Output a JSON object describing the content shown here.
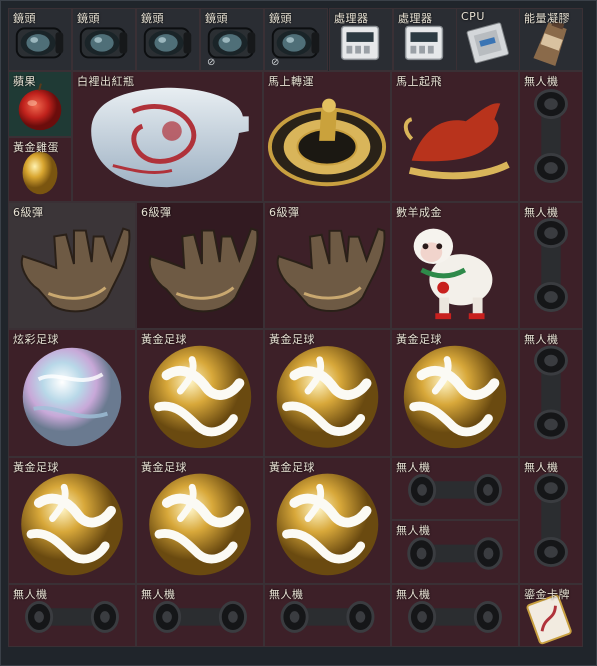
{
  "colors": {
    "panel_bg": "#20252b",
    "cell_dark": "#2a2d33",
    "cell_maroon": "#3d2028",
    "cell_maroon_dark": "#321a21",
    "cell_grey": "#3b3538",
    "cell_teal": "#1f3a35",
    "label_text": "#e8e2d4"
  },
  "top_row": [
    {
      "label": "鏡頭",
      "icon": "lens-icon",
      "mark": ""
    },
    {
      "label": "鏡頭",
      "icon": "lens-icon",
      "mark": ""
    },
    {
      "label": "鏡頭",
      "icon": "lens-icon",
      "mark": ""
    },
    {
      "label": "鏡頭",
      "icon": "lens-icon",
      "mark": "⊘"
    },
    {
      "label": "鏡頭",
      "icon": "lens-icon",
      "mark": "⊘"
    },
    {
      "label": "處理器",
      "icon": "processor-icon",
      "mark": ""
    },
    {
      "label": "處理器",
      "icon": "processor-icon",
      "mark": ""
    },
    {
      "label": "CPU",
      "icon": "cpu-chip-icon",
      "mark": ""
    },
    {
      "label": "能量凝膠",
      "icon": "energy-gel-icon",
      "mark": ""
    }
  ],
  "items": {
    "apple": {
      "label": "蘋果",
      "icon": "apple-icon"
    },
    "golden_egg": {
      "label": "黃金雞蛋",
      "icon": "golden-egg-icon"
    },
    "vase": {
      "label": "白裡出紅瓶",
      "icon": "porcelain-vase-icon"
    },
    "wheel": {
      "label": "馬上轉運",
      "icon": "fortune-wheel-icon"
    },
    "horse": {
      "label": "馬上起飛",
      "icon": "flying-horse-icon"
    },
    "drone_r1": {
      "label": "無人機",
      "icon": "drone-part-icon"
    },
    "glove1": {
      "label": "6級彈",
      "icon": "gauntlet-icon"
    },
    "glove2": {
      "label": "6級彈",
      "icon": "gauntlet-icon"
    },
    "glove3": {
      "label": "6級彈",
      "icon": "gauntlet-icon"
    },
    "sheep": {
      "label": "數羊成金",
      "icon": "sheep-figure-icon"
    },
    "drone_r2": {
      "label": "無人機",
      "icon": "drone-part-icon"
    },
    "colorball": {
      "label": "炫彩足球",
      "icon": "iridescent-football-icon"
    },
    "gold1": {
      "label": "黃金足球",
      "icon": "golden-football-icon"
    },
    "gold2": {
      "label": "黃金足球",
      "icon": "golden-football-icon"
    },
    "gold3": {
      "label": "黃金足球",
      "icon": "golden-football-icon"
    },
    "drone_r3": {
      "label": "無人機",
      "icon": "drone-part-icon"
    },
    "gold4": {
      "label": "黃金足球",
      "icon": "golden-football-icon"
    },
    "gold5": {
      "label": "黃金足球",
      "icon": "golden-football-icon"
    },
    "gold6": {
      "label": "黃金足球",
      "icon": "golden-football-icon"
    },
    "drone_r4a": {
      "label": "無人機",
      "icon": "drone-part-icon"
    },
    "drone_r4b": {
      "label": "無人機",
      "icon": "drone-part-icon"
    },
    "drone_r4c": {
      "label": "無人機",
      "icon": "drone-part-icon"
    },
    "drone_r5a": {
      "label": "無人機",
      "icon": "drone-part-icon"
    },
    "drone_r5b": {
      "label": "無人機",
      "icon": "drone-part-icon"
    },
    "drone_r5c": {
      "label": "無人機",
      "icon": "drone-part-icon"
    },
    "drone_r5d": {
      "label": "無人機",
      "icon": "drone-part-icon"
    },
    "card": {
      "label": "鎏金卡牌",
      "icon": "gilded-card-icon"
    }
  }
}
